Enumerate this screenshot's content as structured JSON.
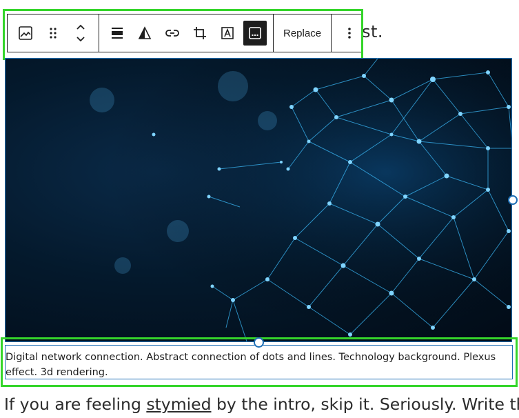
{
  "paragraph_above": {
    "visible_fragment": "st."
  },
  "toolbar": {
    "block_type_icon": "image-icon",
    "drag_icon": "drag-handle-icon",
    "move_icon": "chevron-up-down-icon",
    "align_icon": "align-icon",
    "duotone_icon": "duotone-icon",
    "link_icon": "link-icon",
    "crop_icon": "crop-icon",
    "text_overlay_icon": "text-overlay-icon",
    "caption_icon": "caption-icon",
    "replace_label": "Replace",
    "options_icon": "more-vertical-icon"
  },
  "image": {
    "alt": "Digital network connection plexus"
  },
  "caption": {
    "text": "Digital network connection. Abstract connection of dots and lines. Technology background. Plexus effect. 3d rendering."
  },
  "paragraph_below": {
    "before": "If you are feeling ",
    "link": "stymied",
    "after": " by the intro, skip it. Seriously. Write the"
  },
  "colors": {
    "highlight": "#35d52a",
    "selection": "#1e6fb5",
    "toolbar_text": "#1e1e1e",
    "active_button": "#1e1e1e"
  }
}
